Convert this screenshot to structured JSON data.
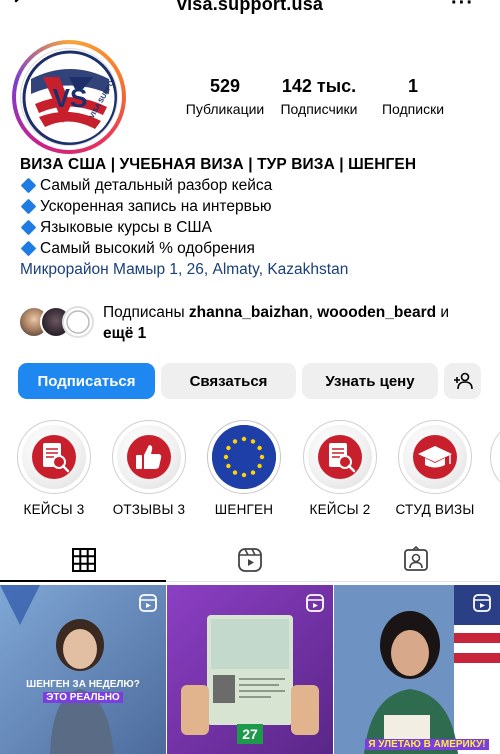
{
  "header": {
    "username": "visa.support.usa",
    "back_icon": "chevron-left-icon",
    "more_icon": "more-dots-icon"
  },
  "profile": {
    "avatar_logo_text": "VISA SUPPORT",
    "avatar_logo_letters": "VS",
    "stats": [
      {
        "value": "529",
        "label": "Публикации"
      },
      {
        "value": "142 тыс.",
        "label": "Подписчики"
      },
      {
        "value": "1",
        "label": "Подписки"
      }
    ]
  },
  "bio": {
    "title": "ВИЗА США | УЧЕБНАЯ ВИЗА | ТУР ВИЗА | ШЕНГЕН",
    "lines": [
      "Самый детальный разбор кейса",
      "Ускоренная запись на интервью",
      "Языковые курсы в США",
      "Самый высокий % одобрения"
    ],
    "location": "Микрорайон Мамыр 1, 26, Almaty, Kazakhstan"
  },
  "followed_by": {
    "prefix": "Подписаны ",
    "user1": "zhanna_baizhan",
    "sep": ", ",
    "user2": "woooden_beard",
    "suffix": " и",
    "more": "ещё 1"
  },
  "actions": {
    "follow": "Подписаться",
    "contact": "Связаться",
    "price": "Узнать цену",
    "add_person_icon": "add-person-icon"
  },
  "highlights": [
    {
      "label": "КЕЙСЫ 3",
      "icon": "case-document-icon"
    },
    {
      "label": "ОТЗЫВЫ 3",
      "icon": "thumbs-up-icon"
    },
    {
      "label": "ШЕНГЕН",
      "icon": "eu-flag-icon"
    },
    {
      "label": "КЕЙСЫ 2",
      "icon": "case-document-icon"
    },
    {
      "label": "СТУД ВИЗЫ",
      "icon": "graduation-cap-icon"
    }
  ],
  "tabs": [
    "grid-icon",
    "reels-icon",
    "tagged-icon"
  ],
  "posts": [
    {
      "caption_line1": "ШЕНГЕН ЗА НЕДЕЛЮ?",
      "caption_line2": "ЭТО РЕАЛЬНО"
    },
    {
      "caption_line1": "27",
      "caption_line2": ""
    },
    {
      "caption_line1": "Я УЛЕТАЮ В АМЕРИКУ!",
      "caption_line2": ""
    }
  ],
  "colors": {
    "primary_button": "#1e88f0",
    "bullet": "#1e7be2",
    "highlight_red": "#c81f2c"
  }
}
